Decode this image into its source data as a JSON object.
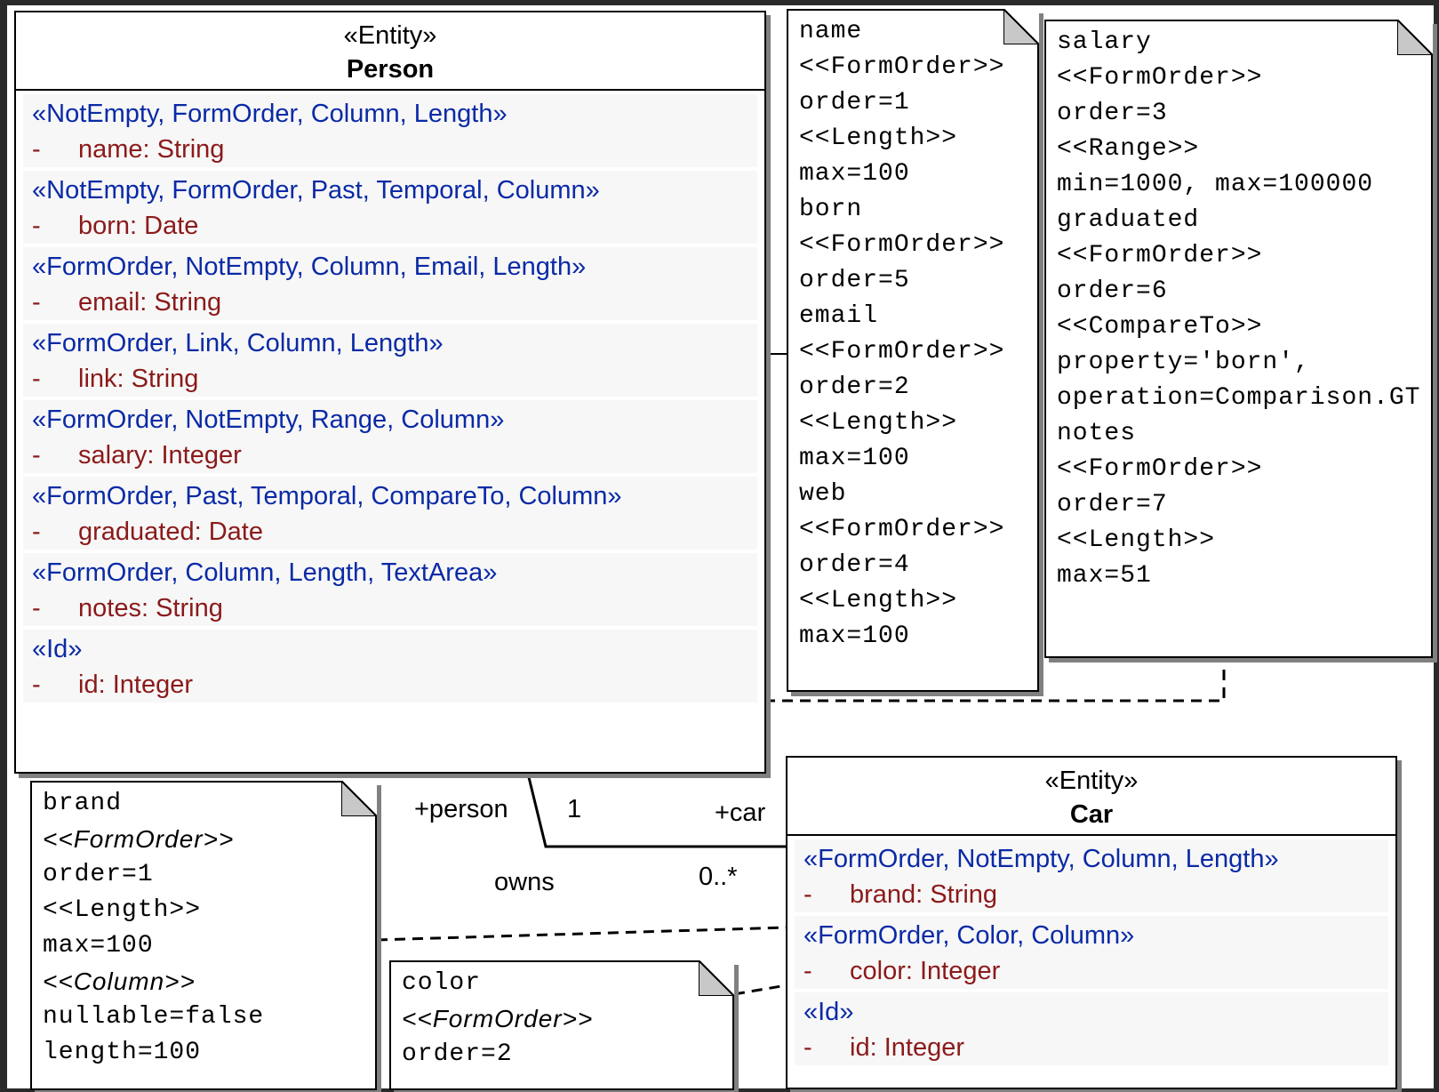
{
  "person": {
    "stereotype": "«Entity»",
    "name": "Person",
    "attributes": [
      {
        "stereotypes": "«NotEmpty, FormOrder, Column, Length»",
        "visibility": "-",
        "name": "name:",
        "type": "String"
      },
      {
        "stereotypes": "«NotEmpty, FormOrder, Past, Temporal, Column»",
        "visibility": "-",
        "name": "born:",
        "type": "Date"
      },
      {
        "stereotypes": "«FormOrder, NotEmpty, Column, Email, Length»",
        "visibility": "-",
        "name": "email:",
        "type": "String"
      },
      {
        "stereotypes": "«FormOrder, Link, Column, Length»",
        "visibility": "-",
        "name": "link:",
        "type": "String"
      },
      {
        "stereotypes": "«FormOrder, NotEmpty, Range, Column»",
        "visibility": "-",
        "name": "salary:",
        "type": "Integer"
      },
      {
        "stereotypes": "«FormOrder, Past, Temporal, CompareTo, Column»",
        "visibility": "-",
        "name": "graduated:",
        "type": "Date"
      },
      {
        "stereotypes": "«FormOrder, Column, Length, TextArea»",
        "visibility": "-",
        "name": "notes:",
        "type": "String"
      },
      {
        "stereotypes": "«Id»",
        "visibility": "-",
        "name": "id:",
        "type": "Integer"
      }
    ]
  },
  "car": {
    "stereotype": "«Entity»",
    "name": "Car",
    "attributes": [
      {
        "stereotypes": "«FormOrder, NotEmpty, Column, Length»",
        "visibility": "-",
        "name": "brand:",
        "type": "String"
      },
      {
        "stereotypes": "«FormOrder, Color, Column»",
        "visibility": "-",
        "name": "color:",
        "type": "Integer"
      },
      {
        "stereotypes": "«Id»",
        "visibility": "-",
        "name": "id:",
        "type": "Integer"
      }
    ]
  },
  "notes": {
    "person_note_1": [
      "name",
      "<<FormOrder>>",
      "order=1",
      "<<Length>>",
      "max=100",
      "born",
      "<<FormOrder>>",
      "order=5",
      "email",
      "<<FormOrder>>",
      "order=2",
      "<<Length>>",
      "max=100",
      "web",
      "<<FormOrder>>",
      "order=4",
      "<<Length>>",
      "max=100"
    ],
    "person_note_2": [
      "salary",
      "<<FormOrder>>",
      "order=3",
      "<<Range>>",
      "min=1000, max=100000",
      "graduated",
      "<<FormOrder>>",
      "order=6",
      "<<CompareTo>>",
      "property='born',",
      "operation=Comparison.GT",
      "notes",
      "<<FormOrder>>",
      "order=7",
      "<<Length>>",
      "max=51"
    ],
    "brand_note": [
      "brand",
      "<<FormOrder>>",
      "order=1",
      "<<Length>>",
      "max=100",
      "<<Column>>",
      "nullable=false",
      "length=100"
    ],
    "color_note": [
      "color",
      "<<FormOrder>>",
      "order=2"
    ]
  },
  "association": {
    "role_person": "+person",
    "mult_person": "1",
    "role_car": "+car",
    "mult_car": "0..*",
    "name": "owns"
  }
}
